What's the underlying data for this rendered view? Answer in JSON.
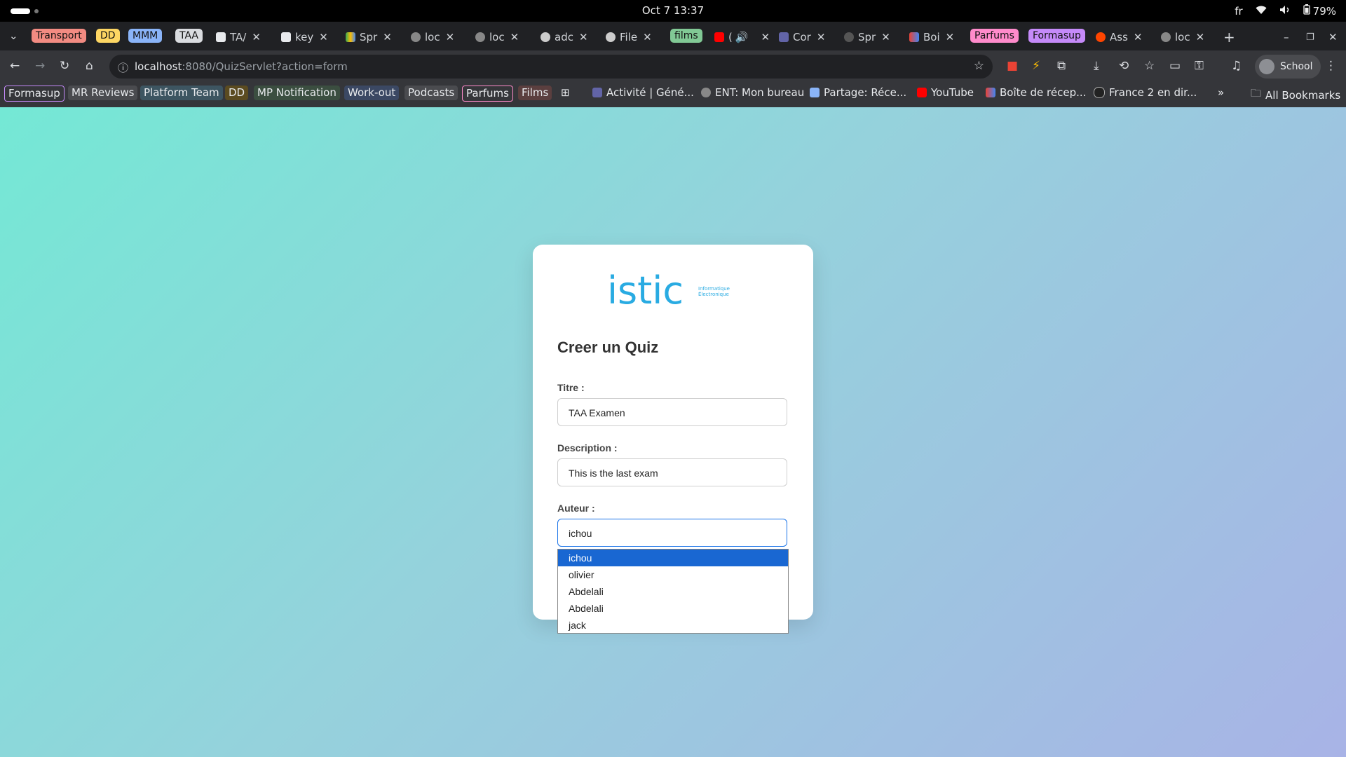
{
  "system": {
    "datetime": "Oct 7  13:37",
    "lang": "fr",
    "battery": "79%"
  },
  "tabs": [
    {
      "type": "group",
      "label": "Transport",
      "color": "#f28b82"
    },
    {
      "type": "group",
      "label": "DD",
      "color": "#fdd663"
    },
    {
      "type": "group",
      "label": "MMM",
      "color": "#8ab4f8"
    },
    {
      "type": "group",
      "label": "TAA",
      "color": "#dadce0"
    },
    {
      "type": "tab",
      "label": "TA/",
      "icon": "doc-icon"
    },
    {
      "type": "tab",
      "label": "key",
      "icon": "doc-icon"
    },
    {
      "type": "tab",
      "label": "Spr",
      "icon": "drive-icon"
    },
    {
      "type": "tab",
      "label": "loc",
      "icon": "globe-icon"
    },
    {
      "type": "tab",
      "label": "loc",
      "icon": "globe-icon"
    },
    {
      "type": "tab",
      "label": "adc",
      "icon": "github-icon"
    },
    {
      "type": "tab",
      "label": "File",
      "icon": "github-icon"
    },
    {
      "type": "group",
      "label": "films",
      "color": "#81c995"
    },
    {
      "type": "tab",
      "label": "(",
      "icon": "youtube-icon"
    },
    {
      "type": "tab",
      "label": "Cor",
      "icon": "teams-icon"
    },
    {
      "type": "tab",
      "label": "Spr",
      "icon": "spring-icon"
    },
    {
      "type": "tab",
      "label": "Boi",
      "icon": "gmail-icon"
    },
    {
      "type": "group",
      "label": "Parfums",
      "color": "#ff8bcb"
    },
    {
      "type": "group",
      "label": "Formasup",
      "color": "#c58af9"
    },
    {
      "type": "tab",
      "label": "Ass",
      "icon": "reddit-icon"
    },
    {
      "type": "tab",
      "label": "loc",
      "icon": "globe-icon"
    }
  ],
  "toolbar": {
    "url_host": "localhost",
    "url_rest": ":8080/QuizServlet?action=form",
    "profile": "School"
  },
  "bookmarks": [
    {
      "label": "Formasup",
      "color": "#c58af9"
    },
    {
      "label": "MR Reviews",
      "color": "#dadce0"
    },
    {
      "label": "Platform Team",
      "color": "#78d9ec"
    },
    {
      "label": "DD",
      "color": "#fdd663"
    },
    {
      "label": "MP Notification",
      "color": "#a8dab5"
    },
    {
      "label": "Work-out",
      "color": "#8ab4f8"
    },
    {
      "label": "Podcasts",
      "color": "#dadce0"
    },
    {
      "label": "Parfums",
      "color": "#ff8bcb"
    },
    {
      "label": "Films",
      "color": "#f28b82"
    },
    {
      "label": "Activité | Géné...",
      "icon": "teams-icon"
    },
    {
      "label": "ENT: Mon bureau",
      "icon": "globe-icon"
    },
    {
      "label": "Partage: Réce...",
      "icon": "doc-icon"
    },
    {
      "label": "YouTube",
      "icon": "youtube-icon"
    },
    {
      "label": "Boîte de récep...",
      "icon": "gmail-icon"
    },
    {
      "label": "France 2 en dir...",
      "icon": "tv-icon"
    }
  ],
  "all_bookmarks": "All Bookmarks",
  "logo": {
    "main": "istic",
    "sub1": "Informatique",
    "sub2": "Électronique"
  },
  "form": {
    "title": "Creer un Quiz",
    "titre_label": "Titre :",
    "titre_value": "TAA Examen",
    "description_label": "Description :",
    "description_value": "This is the last exam",
    "auteur_label": "Auteur :",
    "auteur_value": "ichou",
    "options": [
      "ichou",
      "olivier",
      "Abdelali",
      "Abdelali",
      "jack"
    ]
  }
}
